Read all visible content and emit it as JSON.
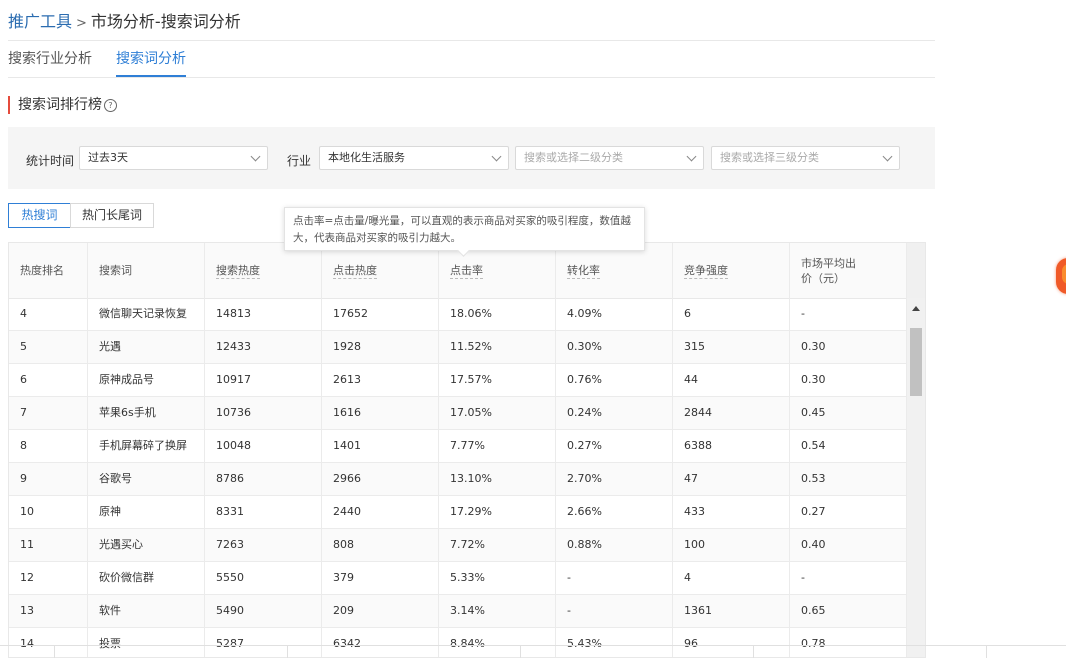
{
  "breadcrumb": {
    "root": "推广工具",
    "separator": ">",
    "current": "市场分析-搜索词分析"
  },
  "tabs": [
    {
      "label": "搜索行业分析",
      "active": false
    },
    {
      "label": "搜索词分析",
      "active": true
    }
  ],
  "section": {
    "title": "搜索词排行榜"
  },
  "filters": {
    "time_label": "统计时间",
    "time_value": "过去3天",
    "industry_label": "行业",
    "industry_value": "本地化生活服务",
    "level2_placeholder": "搜索或选择二级分类",
    "level3_placeholder": "搜索或选择三级分类"
  },
  "segments": [
    {
      "label": "热搜词",
      "active": true
    },
    {
      "label": "热门长尾词",
      "active": false
    }
  ],
  "tooltip": {
    "text": "点击率=点击量/曝光量，可以直观的表示商品对买家的吸引程度，数值越大，代表商品对买家的吸引力越大。"
  },
  "table": {
    "columns": [
      "热度排名",
      "搜索词",
      "搜索热度",
      "点击热度",
      "点击率",
      "转化率",
      "竞争强度",
      "市场平均出价（元）"
    ],
    "rows": [
      [
        "4",
        "微信聊天记录恢复",
        "14813",
        "17652",
        "18.06%",
        "4.09%",
        "6",
        "-"
      ],
      [
        "5",
        "光遇",
        "12433",
        "1928",
        "11.52%",
        "0.30%",
        "315",
        "0.30"
      ],
      [
        "6",
        "原神成品号",
        "10917",
        "2613",
        "17.57%",
        "0.76%",
        "44",
        "0.30"
      ],
      [
        "7",
        "苹果6s手机",
        "10736",
        "1616",
        "17.05%",
        "0.24%",
        "2844",
        "0.45"
      ],
      [
        "8",
        "手机屏幕碎了换屏",
        "10048",
        "1401",
        "7.77%",
        "0.27%",
        "6388",
        "0.54"
      ],
      [
        "9",
        "谷歌号",
        "8786",
        "2966",
        "13.10%",
        "2.70%",
        "47",
        "0.53"
      ],
      [
        "10",
        "原神",
        "8331",
        "2440",
        "17.29%",
        "2.66%",
        "433",
        "0.27"
      ],
      [
        "11",
        "光遇买心",
        "7263",
        "808",
        "7.72%",
        "0.88%",
        "100",
        "0.40"
      ],
      [
        "12",
        "砍价微信群",
        "5550",
        "379",
        "5.33%",
        "-",
        "4",
        "-"
      ],
      [
        "13",
        "软件",
        "5490",
        "209",
        "3.14%",
        "-",
        "1361",
        "0.65"
      ],
      [
        "14",
        "投票",
        "5287",
        "6342",
        "8.84%",
        "5.43%",
        "96",
        "0.78"
      ]
    ]
  }
}
